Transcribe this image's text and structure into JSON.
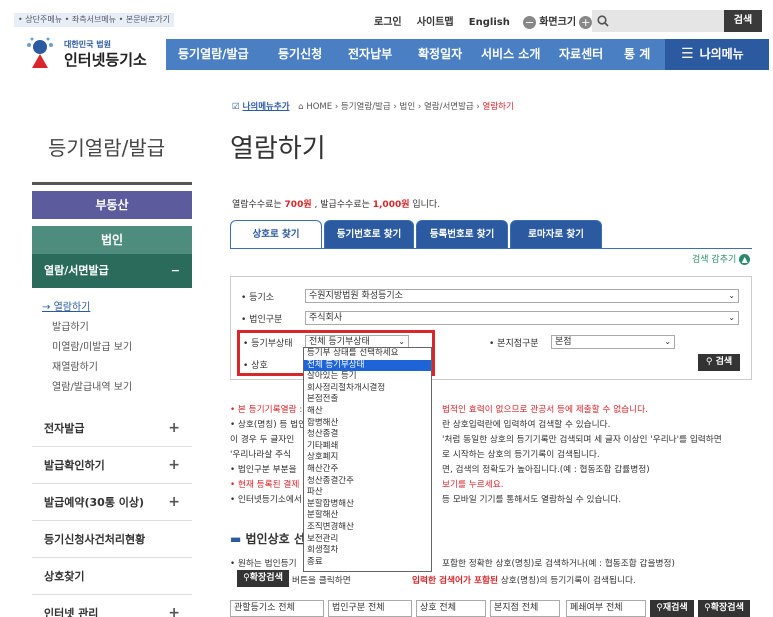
{
  "skip_links": "• 상단주메뉴 • 좌측서브메뉴 • 본문바로가기",
  "topbar": {
    "login": "로그인",
    "sitemap": "사이트맵",
    "english": "English",
    "zoom": "화면크기",
    "search_button": "검색"
  },
  "logo": {
    "small": "대한민국 법원",
    "big": "인터넷등기소"
  },
  "nav": [
    "등기열람/발급",
    "등기신청",
    "전자납부",
    "확정일자",
    "서비스 소개",
    "자료센터",
    "통 계"
  ],
  "mymenu": "나의메뉴",
  "left": {
    "title": "등기열람/발급",
    "real_estate": "부동산",
    "corporation": "법인",
    "section": "열람/서면발급",
    "section_toggle": "−",
    "sub": [
      "열람하기",
      "발급하기",
      "미열람/미발급 보기",
      "재열람하기",
      "열람/발급내역 보기"
    ],
    "menus": [
      "전자발급",
      "발급확인하기",
      "발급예약(30통 이상)",
      "등기신청사건처리현황",
      "상호찾기",
      "인터넷 관리"
    ]
  },
  "breadcrumb": {
    "add": "나의메뉴추가",
    "path": "HOME › 등기열람/발급 › 법인 › 열람/서면발급 › ",
    "current": "열람하기"
  },
  "page_title": "열람하기",
  "fee": {
    "p1": "열람수수료는 ",
    "v1": "700원",
    "p2": " , 발급수수료는 ",
    "v2": "1,000원",
    "p3": " 입니다."
  },
  "tabs": [
    "상호로 찾기",
    "등기번호로 찾기",
    "등록번호로 찾기",
    "로마자로 찾기"
  ],
  "collapse": "검색 감추기",
  "form": {
    "registry_label": "• 등기소",
    "registry_value": "수원지방법원 화성등기소",
    "corp_label": "• 법인구분",
    "corp_value": "주식회사",
    "status_label": "• 등기부상태",
    "status_value": "전체 등기부상태",
    "branch_label": "• 본지점구분",
    "branch_value": "본점",
    "name_label": "• 상호",
    "search": "검색"
  },
  "dropdown_options": [
    "등기부 상태를 선택하세요",
    "전체 등기부상태",
    "살아있는 등기",
    "회사정리절차개시결정",
    "본점전출",
    "해산",
    "합병해산",
    "청산종결",
    "기타폐쇄",
    "상호폐지",
    "해산간주",
    "청산종결간주",
    "파산",
    "분할합병해산",
    "분할해산",
    "조직변경해산",
    "보전관리",
    "회생절차",
    "종료"
  ],
  "notes": [
    {
      "a": "• 본 등기기록열람 :",
      "b": "법적인 효력이 없으므로 관공서 등에 제출할 수 없습니다.",
      "red": true
    },
    {
      "a": "• 상호(명칭) 등 법인",
      "b": "란 상호입력란에 입력하여 검색할 수 있습니다."
    },
    {
      "a": "  이 경우 두 글자인",
      "b": "'처럼 동일한 상호의 등기기록만 검색되며 세 글자 이상인 '우리나'를 입력하면"
    },
    {
      "a": "  '우리나라살 주식",
      "b": "로 시작하는 상호의 등기기록이 검색됩니다."
    },
    {
      "a": "• 법인구분 부분을",
      "b": "면, 검색의 정확도가 높아집니다.(예 : 협동조합 갑률병정)"
    },
    {
      "a": "• 현재 등록된 결제",
      "b": "보기를 누르세요."
    },
    {
      "a": "• 인터넷등기소에서",
      "b": "등 모바일 기기를 통해서도 열람하실 수 있습니다."
    }
  ],
  "section2": {
    "title": "법인상호 선",
    "line1a": "• 원하는 법인등기",
    "line1b": "포함한 정확한 상호(명칭)로 검색하거나(예 : 협동조합 갑을병정)",
    "expand_btn": "확장검색",
    "line2a": "버튼을 클릭하면",
    "line2b": "입력한 검색어가 포함된",
    "line2c": " 상호(명칭)의 등기기록이 검색됩니다."
  },
  "filters": [
    "관할등기소 전체",
    "법인구분 전체",
    "상호 전체",
    "본지점 전체",
    "폐쇄여부 전체"
  ],
  "filter_buttons": [
    "재검색",
    "확장검색"
  ],
  "colors": {
    "nav": "#4a7fc4",
    "red": "#d9262b",
    "highlight": "#1e64d6",
    "left_dark": "#5b5b9e"
  }
}
